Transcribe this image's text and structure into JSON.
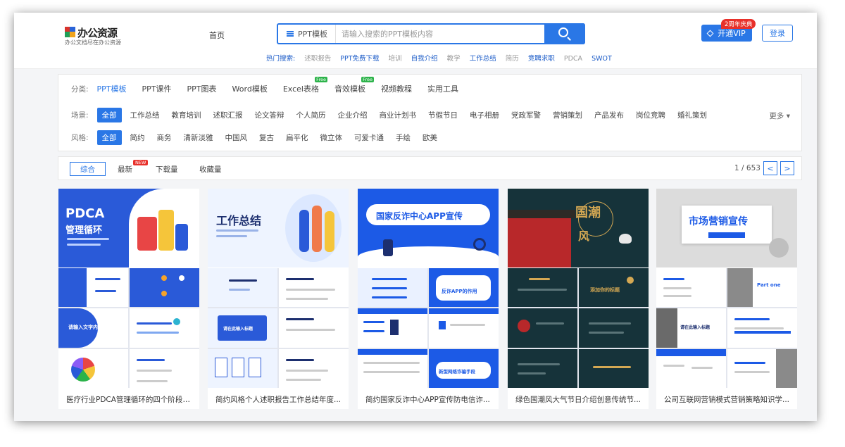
{
  "header": {
    "logo_title": "办公资源",
    "logo_sub": "办公文档尽在办公资源",
    "nav_home": "首页",
    "search_category": "PPT模板",
    "search_placeholder": "请输入搜索的PPT模板内容",
    "hot_label": "热门搜索:",
    "hot_items": [
      "述职报告",
      "PPT免费下载",
      "培训",
      "自我介绍",
      "教学",
      "工作总结",
      "简历",
      "竞聘求职",
      "PDCA",
      "SWOT"
    ],
    "vip_label": "开通VIP",
    "vip_badge": "2周年庆典",
    "login_label": "登录"
  },
  "filters": {
    "category_label": "分类:",
    "categories": [
      "PPT模板",
      "PPT课件",
      "PPT图表",
      "Word模板",
      "Excel表格",
      "音效模板",
      "视频教程",
      "实用工具"
    ],
    "free_badge": "Free",
    "scene_label": "场景:",
    "scenes": [
      "全部",
      "工作总结",
      "教育培训",
      "述职汇报",
      "论文答辩",
      "个人简历",
      "企业介绍",
      "商业计划书",
      "节假节日",
      "电子相册",
      "党政军警",
      "营销策划",
      "产品发布",
      "岗位竞聘",
      "婚礼策划"
    ],
    "more_label": "更多",
    "style_label": "风格:",
    "styles": [
      "全部",
      "简约",
      "商务",
      "清新淡雅",
      "中国风",
      "复古",
      "扁平化",
      "微立体",
      "可爱卡通",
      "手绘",
      "欧美"
    ]
  },
  "sort": {
    "items": [
      "综合",
      "最新",
      "下载量",
      "收藏量"
    ],
    "new_badge": "NEW",
    "page_info": "1 / 653",
    "prev": "<",
    "next": ">"
  },
  "cards": [
    {
      "title": "医疗行业PDCA管理循环的四个阶段质...",
      "cover_text": "PDCA",
      "cover_sub": "管理循环",
      "slide_text": "请输入文字内容"
    },
    {
      "title": "简约风格个人述职报告工作总结年度...",
      "cover_text": "工作总结",
      "slide_text": "请在此输入标题"
    },
    {
      "title": "简约国家反诈中心APP宣传防电信诈...",
      "cover_text": "国家反诈中心APP宣传",
      "slide_text": "反诈APP的作用",
      "slide_text2": "新型网络诈骗手段"
    },
    {
      "title": "绿色国潮风大气节日介绍创意传统节...",
      "cover_text": "国潮",
      "cover_text2": "风",
      "slide_text": "添加你的标题"
    },
    {
      "title": "公司互联网营销模式营销策略知识学...",
      "cover_text": "市场营销宣传",
      "slide_text": "请在此输入标题",
      "slide_text2": "Part one"
    }
  ],
  "colors": {
    "accent": "#2a77e6",
    "badge_red": "#e8302a",
    "free_green": "#2cb34a"
  }
}
